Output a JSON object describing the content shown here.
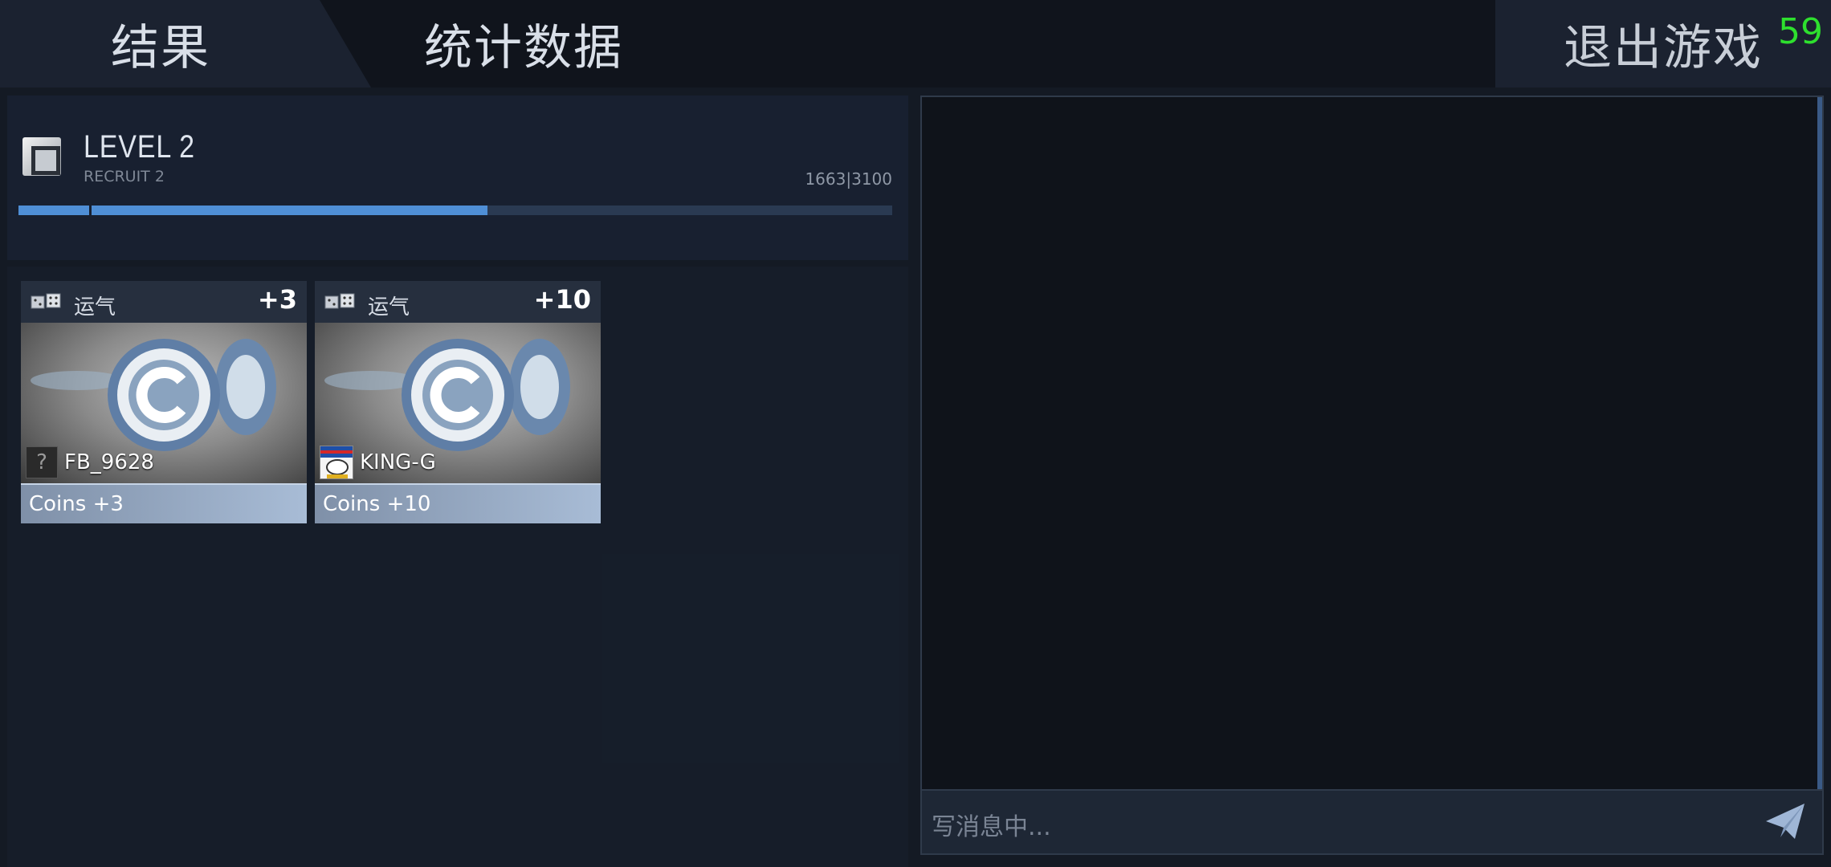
{
  "header": {
    "tab_results": "结果",
    "tab_stats": "统计数据",
    "exit_label": "退出游戏",
    "timer": "59"
  },
  "level": {
    "title": "LEVEL 2",
    "rank": "RECRUIT 2",
    "xp_text": "1663|3100",
    "xp_current": 1663,
    "xp_total": 3100,
    "fill_color": "#4f8fd6"
  },
  "rewards": [
    {
      "type": "运气",
      "amount": "+3",
      "player": "FB_9628",
      "avatar": "unknown-avatar-icon",
      "footer": "Coins +3"
    },
    {
      "type": "运气",
      "amount": "+10",
      "player": "KING-G",
      "avatar": "king-avatar-icon",
      "footer": "Coins +10"
    }
  ],
  "chat": {
    "placeholder": "写消息中..."
  }
}
